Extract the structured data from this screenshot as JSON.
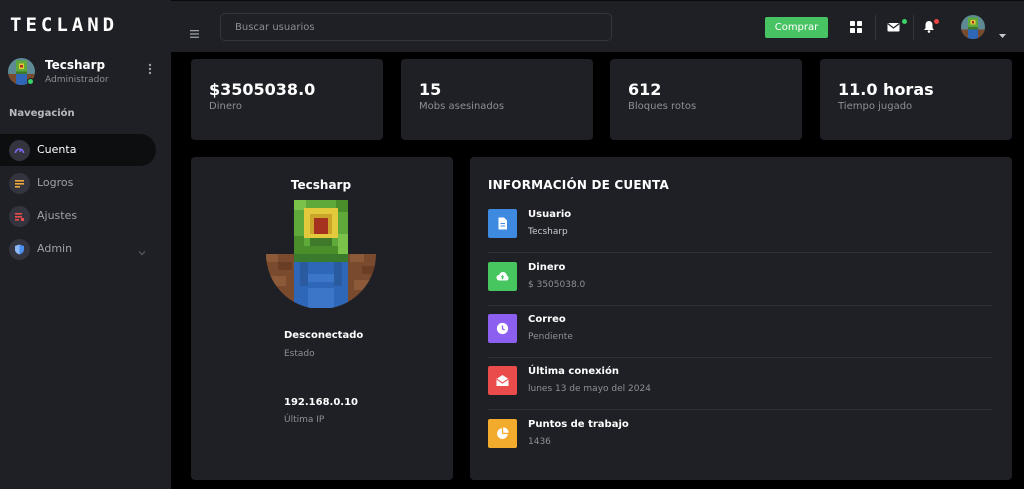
{
  "brand": "TECLAND",
  "user": {
    "name": "Tecsharp",
    "role": "Administrador"
  },
  "nav": {
    "heading": "Navegación",
    "items": [
      {
        "label": "Cuenta",
        "icon": "gauge-icon",
        "color": "#7b6cf0"
      },
      {
        "label": "Logros",
        "icon": "list-icon",
        "color": "#f0a83a"
      },
      {
        "label": "Ajustes",
        "icon": "list-edit-icon",
        "color": "#e84c4c"
      },
      {
        "label": "Admin",
        "icon": "shield-icon",
        "color": "#4a8ef0"
      }
    ]
  },
  "topbar": {
    "search_placeholder": "Buscar usuarios",
    "buy_label": "Comprar"
  },
  "stats": [
    {
      "value": "$3505038.0",
      "label": "Dinero"
    },
    {
      "value": "15",
      "label": "Mobs asesinados"
    },
    {
      "value": "612",
      "label": "Bloques rotos"
    },
    {
      "value": "11.0 horas",
      "label": "Tiempo jugado"
    }
  ],
  "profile": {
    "name": "Tecsharp",
    "status_value": "Desconectado",
    "status_label": "Estado",
    "ip_value": "192.168.0.10",
    "ip_label": "Última IP"
  },
  "account_info": {
    "title": "INFORMACIÓN DE CUENTA",
    "rows": [
      {
        "label": "Usuario",
        "value": "Tecsharp",
        "icon": "document-icon",
        "color": "#3d8ae0"
      },
      {
        "label": "Dinero",
        "value": "$ 3505038.0",
        "icon": "cloud-upload-icon",
        "color": "#47c55e"
      },
      {
        "label": "Correo",
        "value": "Pendiente",
        "icon": "clock-icon",
        "color": "#8d5ff0"
      },
      {
        "label": "Última conexión",
        "value": "lunes 13 de mayo del 2024",
        "icon": "envelope-open-icon",
        "color": "#ea4c4c"
      },
      {
        "label": "Puntos de trabajo",
        "value": "1436",
        "icon": "pie-chart-icon",
        "color": "#f3ab2e"
      }
    ]
  }
}
